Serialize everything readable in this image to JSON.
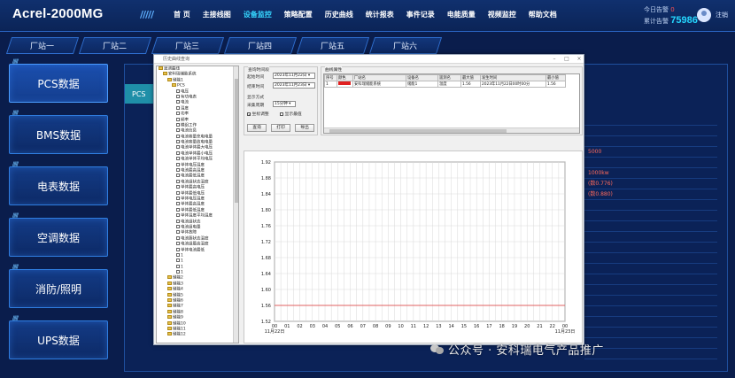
{
  "header": {
    "logo": "Acrel-2000MG",
    "slashes": "/////",
    "nav": [
      "首 页",
      "主接线图",
      "设备监控",
      "策略配置",
      "历史曲线",
      "统计报表",
      "事件记录",
      "电能质量",
      "视频监控",
      "帮助文档"
    ],
    "active_nav_index": 2,
    "alarm_label": "今日告警",
    "alarm_value": "0",
    "users_label": "累计告警",
    "users_value": "75986",
    "logout_label": "注销"
  },
  "station_tabs": [
    "厂站一",
    "厂站二",
    "厂站三",
    "厂站四",
    "厂站五",
    "厂站六"
  ],
  "sidebar": {
    "items": [
      "PCS数据",
      "BMS数据",
      "电表数据",
      "空调数据",
      "消防/照明",
      "UPS数据"
    ],
    "active_index": 0,
    "ornament": "/////"
  },
  "main": {
    "pcs_tag": "PCS",
    "bg_rows": [
      "",
      "",
      "",
      "5000",
      "",
      "1000kw",
      "(数0.776)",
      "(数0.880)",
      "",
      "",
      "",
      "",
      "",
      "",
      "",
      "",
      "",
      "",
      "",
      "",
      "",
      "",
      ""
    ]
  },
  "dialog": {
    "title": "历史曲线查询",
    "tree": {
      "rows": [
        {
          "indent": 0,
          "type": "fold",
          "label": "遥测曲线"
        },
        {
          "indent": 1,
          "type": "fold",
          "label": "安科瑞储能系统"
        },
        {
          "indent": 2,
          "type": "fold",
          "label": "储能1"
        },
        {
          "indent": 3,
          "type": "fold",
          "label": "PCS"
        },
        {
          "indent": 4,
          "type": "chk",
          "label": "电压"
        },
        {
          "indent": 4,
          "type": "chk",
          "label": "有功电表"
        },
        {
          "indent": 4,
          "type": "chk",
          "label": "电流"
        },
        {
          "indent": 4,
          "type": "chk",
          "label": "温度"
        },
        {
          "indent": 4,
          "type": "chk",
          "label": "功率"
        },
        {
          "indent": 4,
          "type": "chk",
          "label": "频率"
        },
        {
          "indent": 4,
          "type": "chk",
          "label": "模组工作"
        },
        {
          "indent": 4,
          "type": "chk",
          "label": "电池信息"
        },
        {
          "indent": 4,
          "type": "chk",
          "label": "电池容量充电电量"
        },
        {
          "indent": 4,
          "type": "chk",
          "label": "电池容量放电电量"
        },
        {
          "indent": 4,
          "type": "chk",
          "label": "电池单体最大电压"
        },
        {
          "indent": 4,
          "type": "chk",
          "label": "电池单体最小电压"
        },
        {
          "indent": 4,
          "type": "chk",
          "label": "电池单体平均电压"
        },
        {
          "indent": 4,
          "type": "chk",
          "label": "单体电压温度"
        },
        {
          "indent": 4,
          "type": "chk",
          "label": "电池最高温度"
        },
        {
          "indent": 4,
          "type": "chk",
          "label": "电池最低温度"
        },
        {
          "indent": 4,
          "type": "chk",
          "label": "电池组状态温度"
        },
        {
          "indent": 4,
          "type": "chk",
          "label": "单体最高电压"
        },
        {
          "indent": 4,
          "type": "chk",
          "label": "单体最低电压"
        },
        {
          "indent": 4,
          "type": "chk",
          "label": "单体电压温度"
        },
        {
          "indent": 4,
          "type": "chk",
          "label": "单体最高温度"
        },
        {
          "indent": 4,
          "type": "chk",
          "label": "单体最低温度"
        },
        {
          "indent": 4,
          "type": "chk",
          "label": "单体温度平均温度"
        },
        {
          "indent": 4,
          "type": "chk",
          "label": "电池组状态"
        },
        {
          "indent": 4,
          "type": "chk",
          "label": "电池组电量"
        },
        {
          "indent": 4,
          "type": "chk",
          "label": "单体故障"
        },
        {
          "indent": 4,
          "type": "chk",
          "label": "电池簇状态温度"
        },
        {
          "indent": 4,
          "type": "chk",
          "label": "电池组最高温度"
        },
        {
          "indent": 4,
          "type": "chk",
          "label": "单体电池最低"
        },
        {
          "indent": 4,
          "type": "chk",
          "label": "1"
        },
        {
          "indent": 4,
          "type": "chk",
          "label": "1"
        },
        {
          "indent": 4,
          "type": "chk",
          "label": "1"
        },
        {
          "indent": 4,
          "type": "chk",
          "label": "1"
        },
        {
          "indent": 2,
          "type": "fold",
          "label": "储能2"
        },
        {
          "indent": 2,
          "type": "fold",
          "label": "储能3"
        },
        {
          "indent": 2,
          "type": "fold",
          "label": "储能4"
        },
        {
          "indent": 2,
          "type": "fold",
          "label": "储能5"
        },
        {
          "indent": 2,
          "type": "fold",
          "label": "储能6"
        },
        {
          "indent": 2,
          "type": "fold",
          "label": "储能7"
        },
        {
          "indent": 2,
          "type": "fold",
          "label": "储能8"
        },
        {
          "indent": 2,
          "type": "fold",
          "label": "储能9"
        },
        {
          "indent": 2,
          "type": "fold",
          "label": "储能10"
        },
        {
          "indent": 2,
          "type": "fold",
          "label": "储能11"
        },
        {
          "indent": 2,
          "type": "fold",
          "label": "储能12"
        }
      ]
    },
    "query": {
      "legend": "查询时间段",
      "start_label": "起始时间",
      "start_value": "2023年11月22日",
      "end_label": "结束时间",
      "end_value": "2023年11月23日",
      "mode_label": "显示方式",
      "period_label": "采集周期",
      "period_value": "15分钟",
      "checkbox1": "坐标调整",
      "checkbox1_checked": true,
      "checkbox2": "显示最值",
      "checkbox2_checked": false,
      "btn_query": "查询",
      "btn_print": "打印",
      "btn_exit": "导出"
    },
    "attributes": {
      "legend": "曲线属性",
      "columns": [
        "序号",
        "颜色",
        "厂站名",
        "设备名",
        "遥测名",
        "最大值",
        "发生时间",
        "最小值"
      ],
      "rows": [
        {
          "index": "1",
          "color": "#e02020",
          "station": "安科瑞储能系统",
          "device": "储能1",
          "measure": "温度",
          "max": "1.56",
          "time": "2023年11月22日00时00分",
          "min": "1.56"
        }
      ]
    },
    "chart": {
      "y_ticks": [
        "1.92",
        "1.88",
        "1.84",
        "1.80",
        "1.76",
        "1.72",
        "1.68",
        "1.64",
        "1.60",
        "1.56",
        "1.52"
      ],
      "x_ticks": [
        "00",
        "01",
        "02",
        "03",
        "04",
        "05",
        "06",
        "07",
        "08",
        "09",
        "10",
        "11",
        "12",
        "13",
        "14",
        "15",
        "16",
        "17",
        "18",
        "19",
        "20",
        "21",
        "22",
        "00"
      ],
      "x_start_date": "11月22日",
      "x_end_date": "11月23日",
      "line_color": "#e06060"
    }
  },
  "chart_data": {
    "type": "line",
    "title": "",
    "xlabel": "",
    "ylabel": "",
    "ylim": [
      1.52,
      1.92
    ],
    "x": [
      "00",
      "01",
      "02",
      "03",
      "04",
      "05",
      "06",
      "07",
      "08",
      "09",
      "10",
      "11",
      "12",
      "13",
      "14",
      "15",
      "16",
      "17",
      "18",
      "19",
      "20",
      "21",
      "22",
      "00"
    ],
    "series": [
      {
        "values": [
          1.56,
          1.56,
          1.56,
          1.56,
          1.56,
          1.56,
          1.56,
          1.56,
          1.56,
          1.56,
          1.56,
          1.56,
          1.56,
          1.56,
          1.56,
          1.56,
          1.56,
          1.56,
          1.56,
          1.56,
          1.56,
          1.56,
          1.56,
          1.56
        ]
      }
    ],
    "grid": true
  },
  "watermark": "公众号 · 安科瑞电气产品推广"
}
